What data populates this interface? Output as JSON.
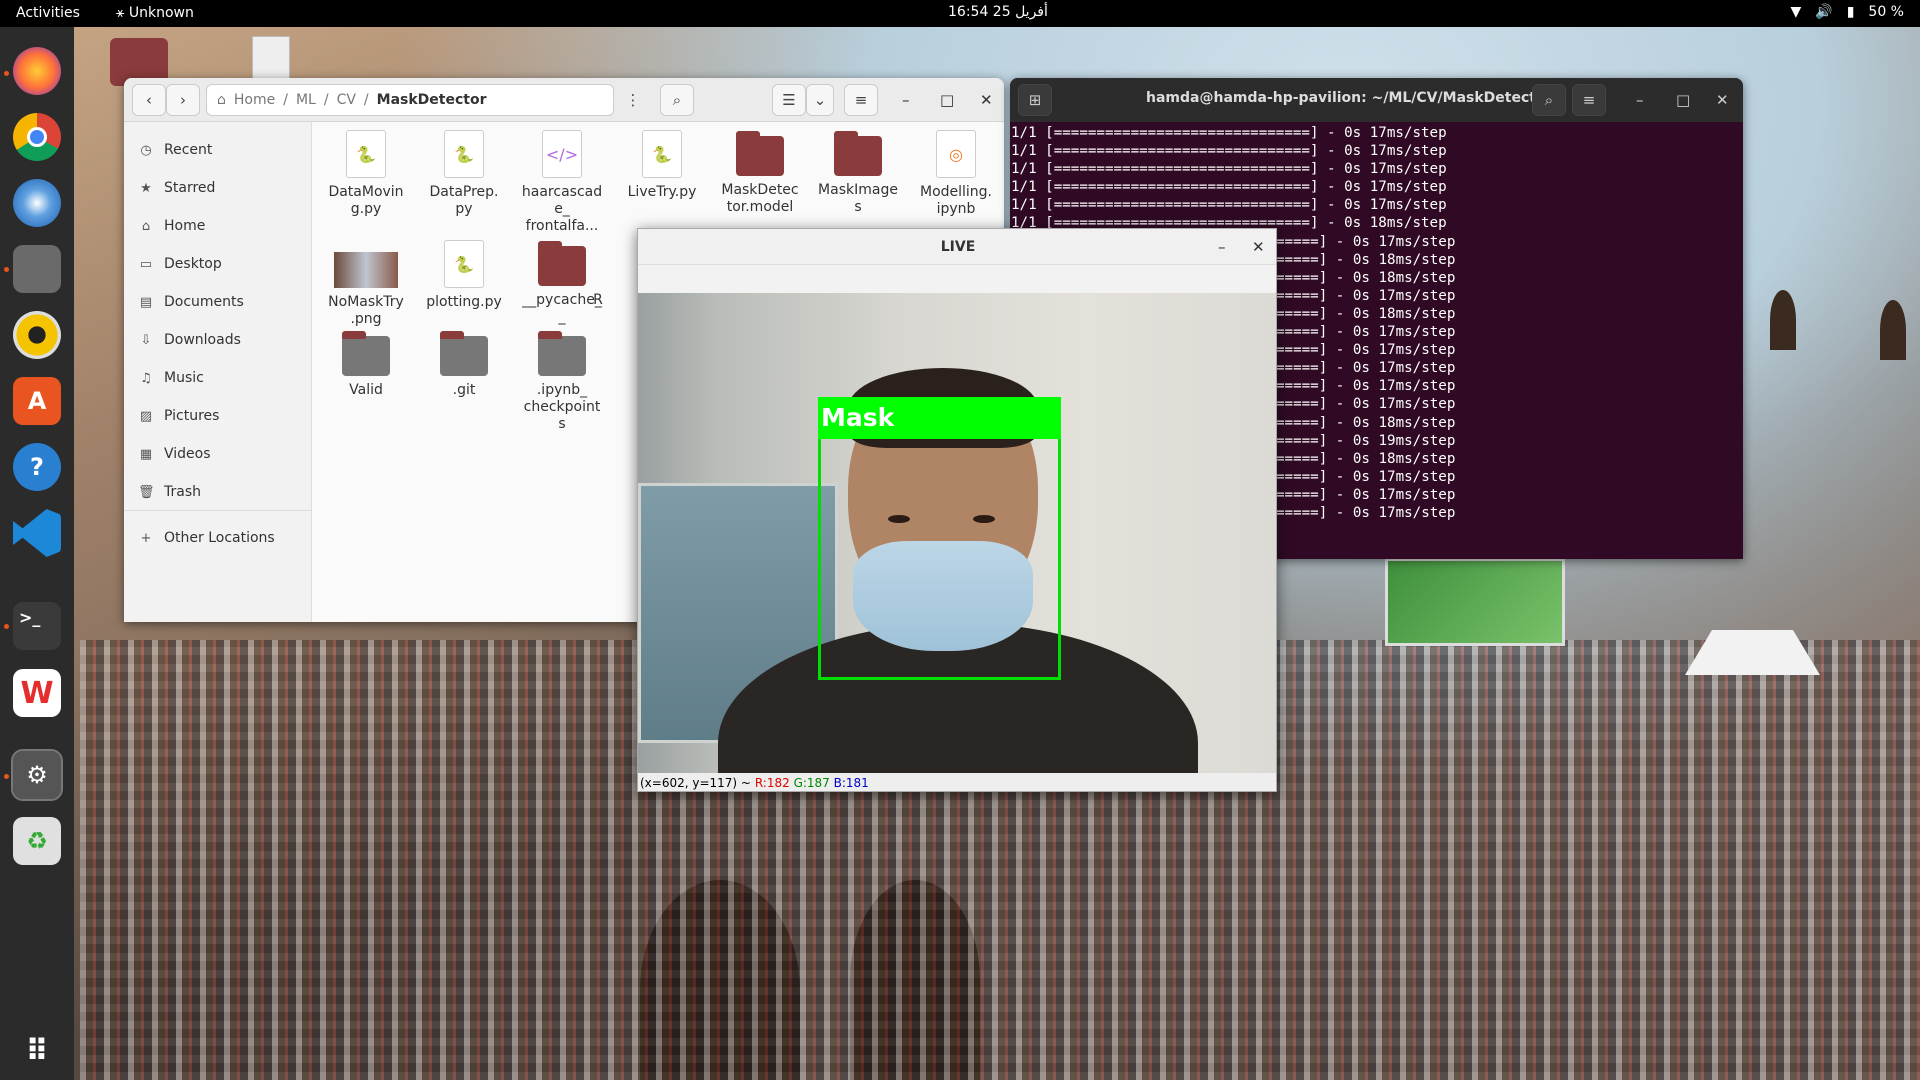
{
  "topbar": {
    "activities": "Activities",
    "app": "Unknown",
    "clock": "16:54 أفريل 25",
    "battery": "50 %"
  },
  "dock": {
    "items": [
      "firefox",
      "chrome",
      "thunderbird",
      "files",
      "rhythmbox",
      "app-center",
      "help",
      "vscode",
      "terminal",
      "wps-office",
      "settings",
      "trash",
      "show-apps"
    ]
  },
  "files": {
    "path": [
      "Home",
      "ML",
      "CV",
      "MaskDetector"
    ],
    "sidebar": [
      "Recent",
      "Starred",
      "Home",
      "Desktop",
      "Documents",
      "Downloads",
      "Music",
      "Pictures",
      "Videos",
      "Trash",
      "Other Locations"
    ],
    "items": [
      {
        "name": "DataMovin\ng.py",
        "kind": "py"
      },
      {
        "name": "DataPrep.\npy",
        "kind": "py"
      },
      {
        "name": "haarcascad\ne_\nfrontalfa...",
        "kind": "xml"
      },
      {
        "name": "LiveTry.py",
        "kind": "py"
      },
      {
        "name": "MaskDetec\ntor.model",
        "kind": "folder"
      },
      {
        "name": "MaskImage\ns",
        "kind": "folder"
      },
      {
        "name": "Modelling.\nipynb",
        "kind": "ipynb"
      },
      {
        "name": "NoMaskTry\n.png",
        "kind": "png"
      },
      {
        "name": "plotting.py",
        "kind": "py"
      },
      {
        "name": "__pycache_\n_",
        "kind": "folder"
      },
      {
        "name": "R",
        "kind": "partial"
      },
      {
        "name": "Valid",
        "kind": "folder"
      },
      {
        "name": ".git",
        "kind": "folder"
      },
      {
        "name": ".ipynb_\ncheckpoint\ns",
        "kind": "folder"
      }
    ]
  },
  "terminal": {
    "title": "hamda@hamda-hp-pavilion: ~/ML/CV/MaskDetector",
    "lines": [
      "1/1 [==============================] - 0s 17ms/step",
      "1/1 [==============================] - 0s 17ms/step",
      "1/1 [==============================] - 0s 17ms/step",
      "1/1 [==============================] - 0s 17ms/step",
      "1/1 [==============================] - 0s 17ms/step",
      "1/1 [==============================] - 0s 18ms/step",
      "=====] - 0s 17ms/step",
      "=====] - 0s 18ms/step",
      "=====] - 0s 18ms/step",
      "=====] - 0s 17ms/step",
      "=====] - 0s 18ms/step",
      "=====] - 0s 17ms/step",
      "=====] - 0s 17ms/step",
      "=====] - 0s 17ms/step",
      "=====] - 0s 17ms/step",
      "=====] - 0s 17ms/step",
      "=====] - 0s 18ms/step",
      "=====] - 0s 19ms/step",
      "=====] - 0s 18ms/step",
      "=====] - 0s 17ms/step",
      "=====] - 0s 17ms/step",
      "=====] - 0s 17ms/step"
    ]
  },
  "live": {
    "title": "LIVE",
    "label": "Mask",
    "status_pos": "(x=602, y=117) ~",
    "status_r": "R:182",
    "status_g": "G:187",
    "status_b": "B:181"
  }
}
